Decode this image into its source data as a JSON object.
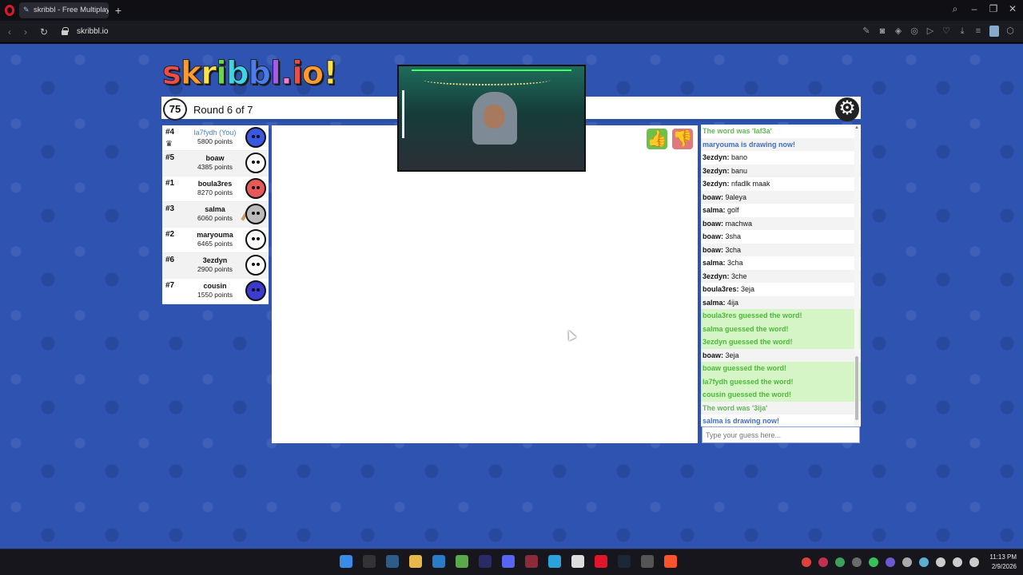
{
  "browser": {
    "tab_title": "skribbl - Free Multiplayer",
    "new_tab": "+",
    "url": "skribbl.io",
    "window_controls": [
      "search-icon",
      "minimize-icon",
      "maximize-icon",
      "close-icon"
    ]
  },
  "game": {
    "logo": "skribbl.io",
    "timer": "75",
    "round": "Round 6 of 7",
    "settings_icon": "gear-icon",
    "players": [
      {
        "rank": "#4",
        "name": "la7fydh (You)",
        "points": "5800 points",
        "you": true,
        "avatar_color": "#3b58e0"
      },
      {
        "rank": "#5",
        "name": "boaw",
        "points": "4385 points",
        "you": false,
        "avatar_color": "#ffffff"
      },
      {
        "rank": "#1",
        "name": "boula3res",
        "points": "8270 points",
        "you": false,
        "avatar_color": "#e85a5a"
      },
      {
        "rank": "#3",
        "name": "salma",
        "points": "6060 points",
        "you": false,
        "avatar_color": "#bbbbbb"
      },
      {
        "rank": "#2",
        "name": "maryouma",
        "points": "6465 points",
        "you": false,
        "avatar_color": "#ffffff"
      },
      {
        "rank": "#6",
        "name": "3ezdyn",
        "points": "2900 points",
        "you": false,
        "avatar_color": "#ffffff"
      },
      {
        "rank": "#7",
        "name": "cousin",
        "points": "1550 points",
        "you": false,
        "avatar_color": "#3b3bd0"
      }
    ],
    "chat": [
      {
        "type": "sys-green",
        "text": "The word was 'laf3a'"
      },
      {
        "type": "sys-blue",
        "text": "maryouma is drawing now!"
      },
      {
        "type": "msg",
        "user": "3ezdyn:",
        "text": " bano"
      },
      {
        "type": "msg",
        "user": "3ezdyn:",
        "text": " banu"
      },
      {
        "type": "msg",
        "user": "3ezdyn:",
        "text": " nfadlk maak"
      },
      {
        "type": "msg",
        "user": "boaw:",
        "text": " 9aleya"
      },
      {
        "type": "msg",
        "user": "salma:",
        "text": " golf"
      },
      {
        "type": "msg",
        "user": "boaw:",
        "text": " machwa"
      },
      {
        "type": "msg",
        "user": "boaw:",
        "text": " 3sha"
      },
      {
        "type": "msg",
        "user": "boaw:",
        "text": " 3cha"
      },
      {
        "type": "msg",
        "user": "salma:",
        "text": " 3cha"
      },
      {
        "type": "msg",
        "user": "3ezdyn:",
        "text": " 3che"
      },
      {
        "type": "msg",
        "user": "boula3res:",
        "text": " 3eja"
      },
      {
        "type": "msg",
        "user": "salma:",
        "text": " 4ija"
      },
      {
        "type": "guessed",
        "text": "boula3res guessed the word!"
      },
      {
        "type": "guessed",
        "text": "salma guessed the word!"
      },
      {
        "type": "guessed",
        "text": "3ezdyn guessed the word!"
      },
      {
        "type": "msg",
        "user": "boaw:",
        "text": " 3eja"
      },
      {
        "type": "guessed",
        "text": "boaw guessed the word!"
      },
      {
        "type": "guessed",
        "text": "la7fydh guessed the word!"
      },
      {
        "type": "guessed",
        "text": "cousin guessed the word!"
      },
      {
        "type": "sys-green",
        "text": "The word was '3ija'"
      },
      {
        "type": "sys-blue",
        "text": "salma is drawing now!"
      }
    ],
    "guess_placeholder": "Type your guess here...",
    "like_icon": "thumbs-up-icon",
    "dislike_icon": "thumbs-down-icon"
  },
  "taskbar": {
    "time": "11:13 PM",
    "date": "2/9/2026"
  }
}
